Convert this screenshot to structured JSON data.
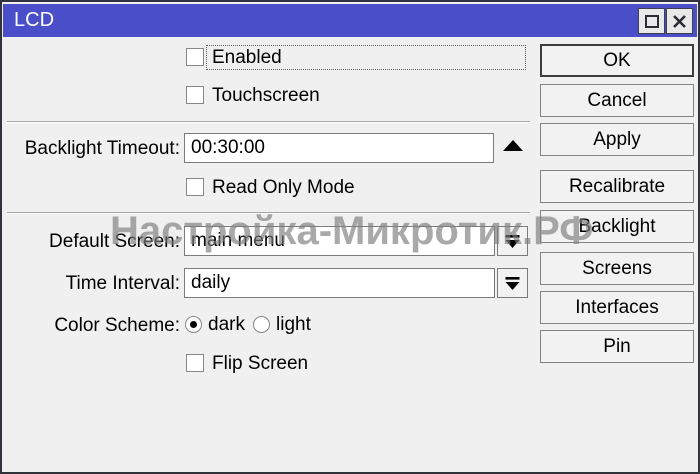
{
  "window": {
    "title": "LCD",
    "titlebar_color": "#4b4ec9",
    "background_color": "#f0f0f0"
  },
  "form": {
    "enabled": {
      "label": "Enabled",
      "checked": false
    },
    "touchscreen": {
      "label": "Touchscreen",
      "checked": false
    },
    "backlight_timeout": {
      "label": "Backlight Timeout:",
      "value": "00:30:00"
    },
    "read_only_mode": {
      "label": "Read Only Mode",
      "checked": false
    },
    "default_screen": {
      "label": "Default Screen:",
      "value": "main menu"
    },
    "time_interval": {
      "label": "Time Interval:",
      "value": "daily"
    },
    "color_scheme": {
      "label": "Color Scheme:",
      "options": [
        {
          "label": "dark",
          "selected": true
        },
        {
          "label": "light",
          "selected": false
        }
      ]
    },
    "flip_screen": {
      "label": "Flip Screen",
      "checked": false
    }
  },
  "buttons": [
    "OK",
    "Cancel",
    "Apply",
    "Recalibrate",
    "Backlight",
    "Screens",
    "Interfaces",
    "Pin"
  ],
  "watermark": "Настройка-Микротик.РФ"
}
